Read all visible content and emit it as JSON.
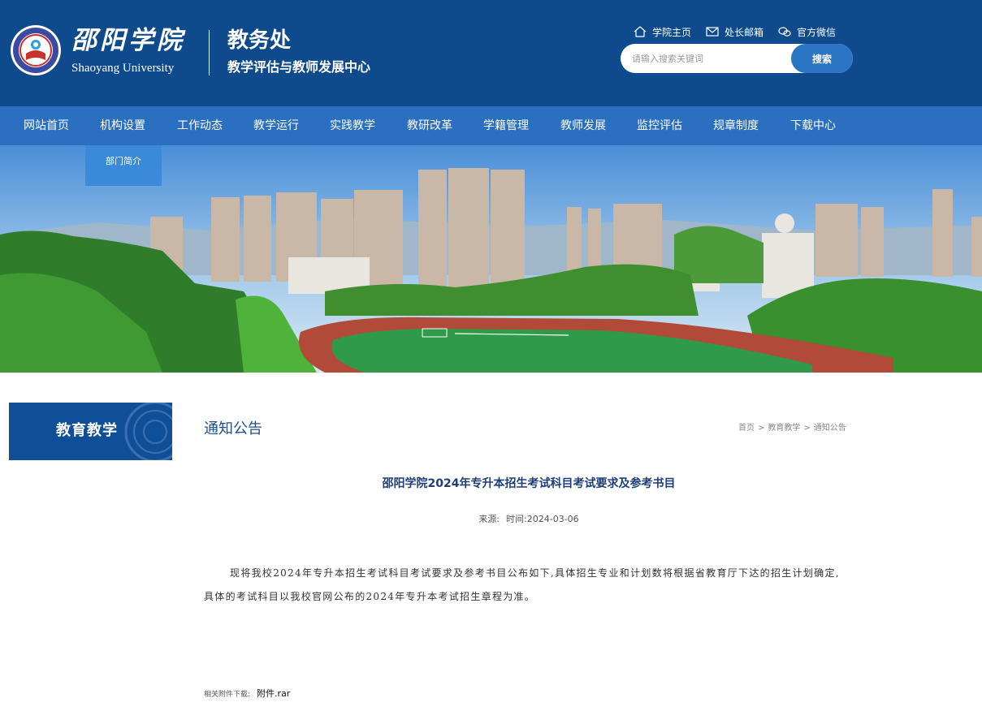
{
  "header": {
    "logo_cn": "邵阳学院",
    "logo_en": "Shaoyang University",
    "dept_title": "教务处",
    "dept_subtitle": "教学评估与教师发展中心",
    "top_links": [
      {
        "label": "学院主页",
        "icon": "home-icon"
      },
      {
        "label": "处长邮箱",
        "icon": "mail-icon"
      },
      {
        "label": "官方微信",
        "icon": "wechat-icon"
      }
    ],
    "search": {
      "placeholder": "请输入搜索关键词",
      "button_label": "搜索"
    }
  },
  "nav": {
    "items": [
      {
        "label": "网站首页"
      },
      {
        "label": "机构设置"
      },
      {
        "label": "工作动态"
      },
      {
        "label": "教学运行"
      },
      {
        "label": "实践教学"
      },
      {
        "label": "教研改革"
      },
      {
        "label": "学籍管理"
      },
      {
        "label": "教师发展"
      },
      {
        "label": "监控评估"
      },
      {
        "label": "规章制度"
      },
      {
        "label": "下载中心"
      }
    ],
    "dropdown": {
      "items": [
        {
          "label": "部门简介"
        }
      ]
    }
  },
  "sidebar": {
    "title": "教育教学"
  },
  "section": {
    "title": "通知公告",
    "breadcrumb": [
      {
        "label": "首页"
      },
      {
        "label": "教育教学"
      },
      {
        "label": "通知公告"
      }
    ],
    "separator": ">"
  },
  "article": {
    "title": "邵阳学院2024年专升本招生考试科目考试要求及参考书目",
    "source_label": "来源:",
    "time_label": "时间:",
    "date": "2024-03-06",
    "body": "现将我校2024年专升本招生考试科目考试要求及参考书目公布如下,具体招生专业和计划数将根据省教育厅下达的招生计划确定,具体的考试科目以我校官网公布的2024年专升本考试招生章程为准。",
    "attachment_label": "相关附件下载:",
    "attachment_file": "附件.rar"
  },
  "colors": {
    "header_bg": "#0e4a8c",
    "nav_bg": "#2a6fc0",
    "dropdown_bg": "#3a8ad9",
    "search_button": "#2c74c4",
    "title_text": "#1f3e78"
  }
}
